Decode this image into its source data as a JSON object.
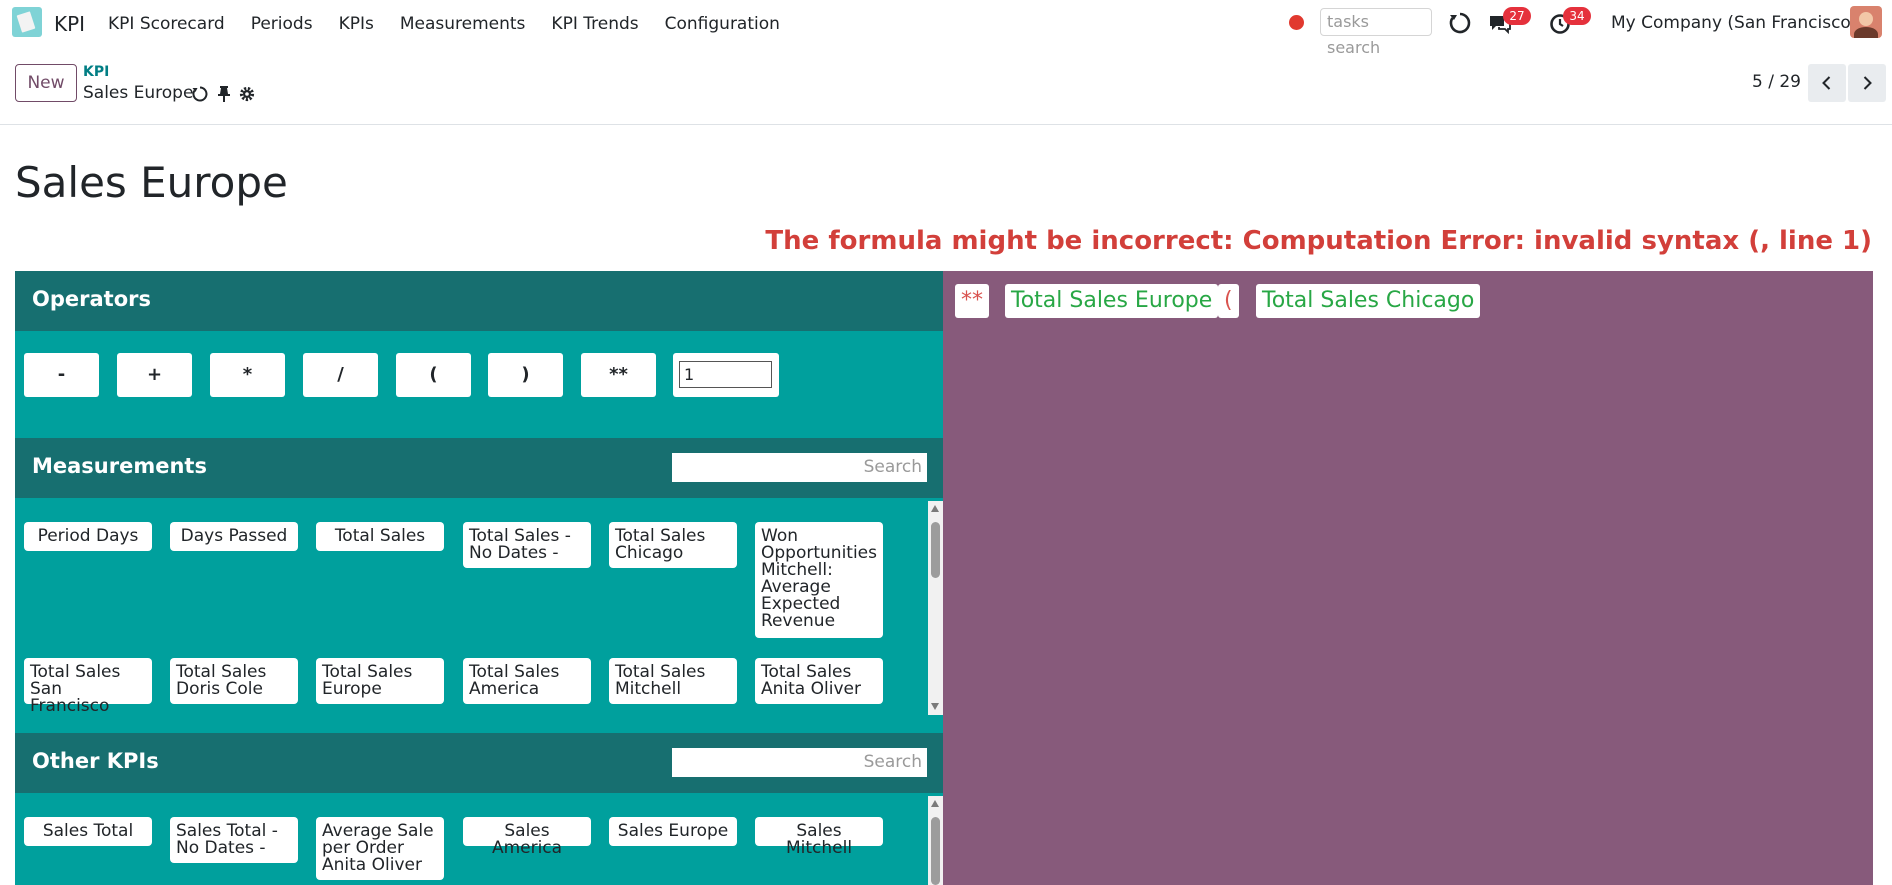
{
  "navbar": {
    "app_name": "KPI",
    "menu": [
      "KPI Scorecard",
      "Periods",
      "KPIs",
      "Measurements",
      "KPI Trends",
      "Configuration"
    ],
    "tasks_search_placeholder": "tasks search",
    "messages_count": "27",
    "activities_count": "34",
    "company": "My Company (San Francisco)"
  },
  "control": {
    "new_label": "New",
    "breadcrumb_parent": "KPI",
    "breadcrumb_current": "Sales Europe",
    "pager": "5 / 29"
  },
  "record": {
    "title": "Sales Europe",
    "error": "The formula might be incorrect: Computation Error: invalid syntax (, line 1)"
  },
  "operators": {
    "title": "Operators",
    "buttons": [
      "-",
      "+",
      "*",
      "/",
      "(",
      ")",
      "**"
    ],
    "number_value": "1"
  },
  "measurements": {
    "title": "Measurements",
    "search_placeholder": "Search",
    "items": [
      "Period Days",
      "Days Passed",
      "Total Sales",
      "Total Sales - No Dates -",
      "Total Sales Chicago",
      "Won Opportunities Mitchell: Average Expected Revenue",
      "Total Sales San Francisco",
      "Total Sales Doris Cole",
      "Total Sales Europe",
      "Total Sales America",
      "Total Sales Mitchell",
      "Total Sales Anita Oliver"
    ]
  },
  "other_kpis": {
    "title": "Other KPIs",
    "search_placeholder": "Search",
    "items": [
      "Sales Total",
      "Sales Total - No Dates -",
      "Average Sale per Order Anita Oliver",
      "Sales America",
      "Sales Europe",
      "Sales Mitchell"
    ]
  },
  "formula": {
    "tokens": [
      "**",
      "Total Sales Europe",
      "(",
      "Total Sales Chicago"
    ],
    "operator_color": "#d9534f",
    "variable_color": "#28a745"
  },
  "colors": {
    "accent": "#714b67",
    "panel_teal": "#00a09d",
    "header_teal": "#176f70",
    "formula_bg": "#875a7b",
    "error": "#d23f3a"
  }
}
